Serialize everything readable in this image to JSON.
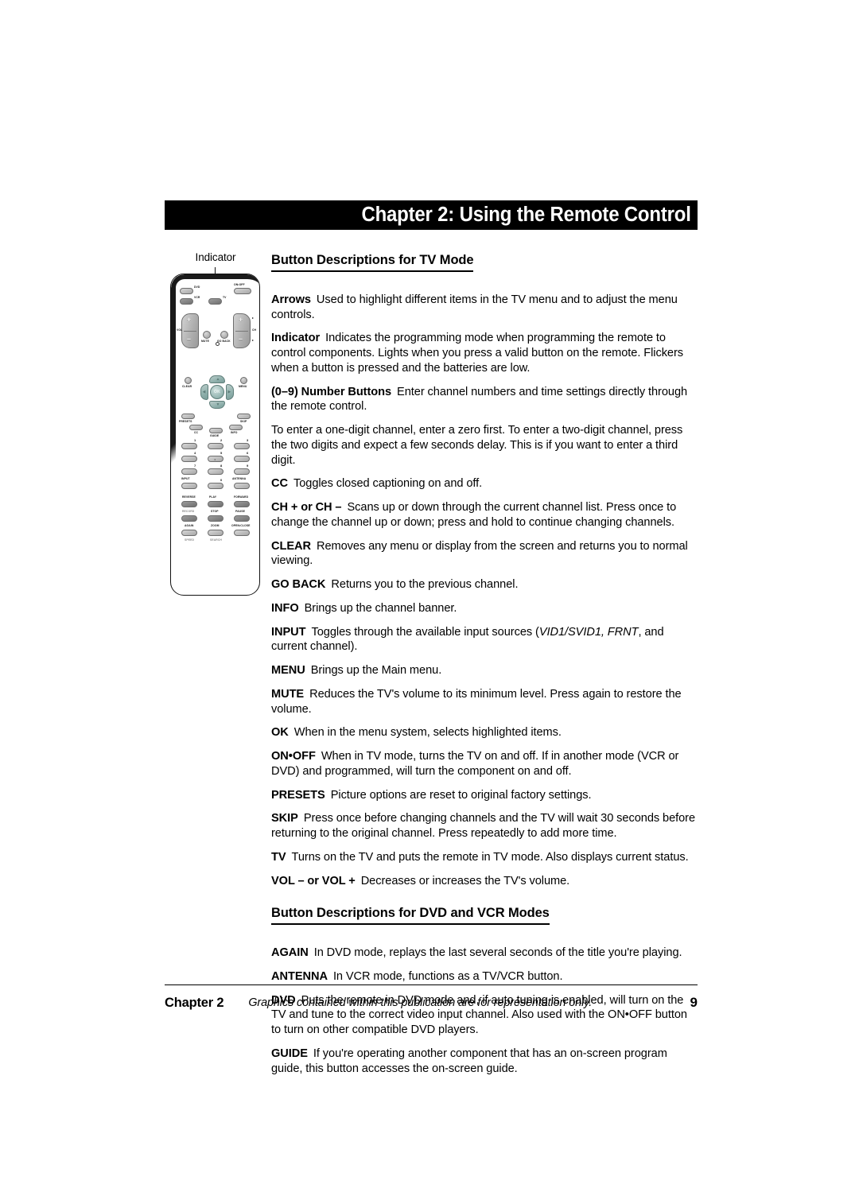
{
  "page": {
    "background": "#ffffff",
    "accent_black": "#000000"
  },
  "header": {
    "chapter_title": "Chapter 2: Using the Remote Control"
  },
  "sections": [
    {
      "heading": "Button Descriptions for TV Mode",
      "entries": [
        {
          "term": "Arrows",
          "text": "Used to highlight different items in the TV menu and to adjust the menu controls."
        },
        {
          "term": "Indicator",
          "text": "Indicates the programming mode when programming the remote to control components. Lights when you press a valid button on the remote. Flickers when a button is pressed and the batteries are low."
        },
        {
          "term": "(0–9) Number Buttons",
          "text": "Enter channel numbers and time settings directly through the remote control."
        },
        {
          "term": "",
          "text": "To enter a one-digit channel, enter a zero first. To enter a two-digit channel, press the two digits and expect a few seconds delay. This is if you want to enter a third digit."
        },
        {
          "term": "CC",
          "text": "Toggles closed captioning on and off."
        },
        {
          "term": "CH + or CH –",
          "text": "Scans up or down through the current channel list. Press once to change the channel up or down; press and hold to continue changing channels."
        },
        {
          "term": "CLEAR",
          "text": "Removes any menu or display from the screen and returns you to normal viewing."
        },
        {
          "term": "GO BACK",
          "text": "Returns you to the previous channel."
        },
        {
          "term": "INFO",
          "text": "Brings up the channel banner."
        },
        {
          "term": "INPUT",
          "text_before": "Toggles through the available input sources (",
          "italic": "VID1/SVID1, FRNT",
          "text_after": ", and current channel)."
        },
        {
          "term": "MENU",
          "text": "Brings up the Main menu."
        },
        {
          "term": "MUTE",
          "text": "Reduces the TV's volume to its minimum level. Press again to restore the volume."
        },
        {
          "term": "OK",
          "text": "When in the menu system, selects highlighted items."
        },
        {
          "term": "ON•OFF",
          "text": "When in TV mode, turns the TV on and off. If in another mode (VCR or DVD) and programmed, will turn the component on and off."
        },
        {
          "term": "PRESETS",
          "text": "Picture options are reset to original factory settings."
        },
        {
          "term": "SKIP",
          "text": "Press once before changing channels and the TV will wait 30 seconds before returning to the original channel. Press repeatedly to add more time."
        },
        {
          "term": "TV",
          "text": "Turns on the TV and puts the remote in TV mode. Also displays current status."
        },
        {
          "term": "VOL – or VOL +",
          "text": "Decreases or increases the TV's volume."
        }
      ]
    },
    {
      "heading": "Button Descriptions for DVD and VCR Modes",
      "entries": [
        {
          "term": "AGAIN",
          "text": "In DVD mode, replays the last several seconds of the title you're playing."
        },
        {
          "term": "ANTENNA",
          "text": "In VCR mode, functions as a TV/VCR button."
        },
        {
          "term": "DVD",
          "text": "Puts the remote in DVD mode and, if auto tuning is enabled, will turn on the TV and tune to the correct video input channel. Also used with the ON•OFF button to turn on other compatible DVD players."
        },
        {
          "term": "GUIDE",
          "text": "If you're operating another component that has an on-screen program guide, this button accesses the on-screen guide."
        }
      ]
    }
  ],
  "figure": {
    "callout_label": "Indicator",
    "buttons": {
      "dvd": "DVD",
      "on_off": "ON•OFF",
      "vcr": "VCR",
      "tv": "TV",
      "vol": "VOL",
      "ch": "CH",
      "mute": "MUTE",
      "go_back": "GO BACK",
      "clear": "CLEAR",
      "menu": "MENU",
      "ok": "OK",
      "presets": "PRESETS",
      "skip": "SKIP",
      "cc": "CC",
      "guide": "GUIDE",
      "info": "INFO",
      "input": "INPUT",
      "antenna": "ANTENNA",
      "reverse": "REVERSE",
      "play": "PLAY",
      "forward": "FORWARD",
      "record": "RECORD",
      "stop": "STOP",
      "pause": "PAUSE",
      "again": "AGAIN",
      "zoom": "ZOOM",
      "open_close": "OPEN•CLOSE",
      "speed": "SPEED",
      "search": "SEARCH",
      "star": "•"
    },
    "number_keys": [
      "1",
      "2",
      "3",
      "4",
      "5",
      "6",
      "7",
      "8",
      "9",
      "0"
    ]
  },
  "footer": {
    "chapter": "Chapter 2",
    "note": "Graphics contained within this publication are for representation only.",
    "page_number": "9"
  }
}
